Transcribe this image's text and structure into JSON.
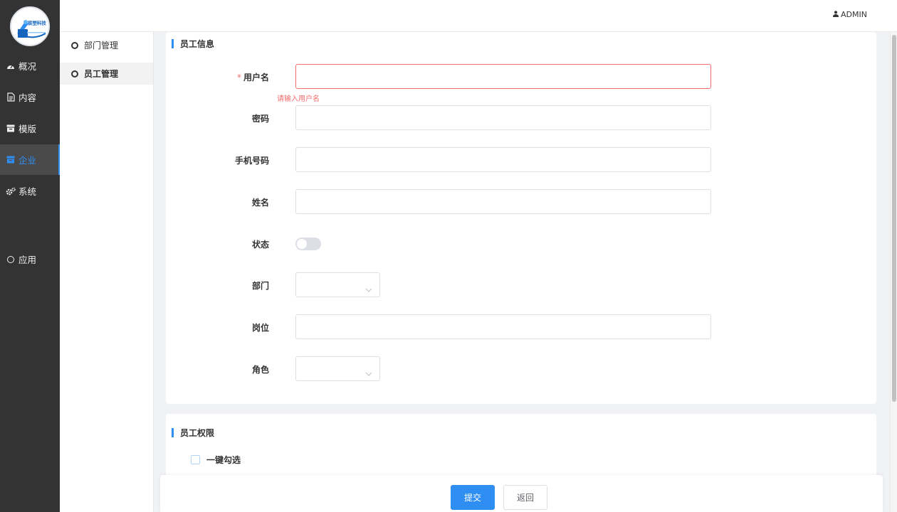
{
  "brand": {
    "logo_text": "宸塑科技"
  },
  "sidebar": {
    "items": [
      {
        "label": "概况",
        "icon": "dashboard-icon",
        "active": false
      },
      {
        "label": "内容",
        "icon": "document-icon",
        "active": false
      },
      {
        "label": "模版",
        "icon": "template-icon",
        "active": false
      },
      {
        "label": "企业",
        "icon": "enterprise-icon",
        "active": true
      },
      {
        "label": "系统",
        "icon": "gears-icon",
        "active": false
      },
      {
        "label": "应用",
        "icon": "circle-icon",
        "active": false
      }
    ]
  },
  "header": {
    "user": "ADMIN",
    "user_icon": "user-icon"
  },
  "submenu": {
    "items": [
      {
        "label": "部门管理",
        "active": false
      },
      {
        "label": "员工管理",
        "active": true
      }
    ]
  },
  "form": {
    "section_title": "员工信息",
    "required_mark": "*",
    "fields": {
      "username": {
        "label": "用户名",
        "value": "",
        "placeholder": "",
        "error": "请输入用户名"
      },
      "password": {
        "label": "密码",
        "value": "",
        "placeholder": ""
      },
      "phone": {
        "label": "手机号码",
        "value": "",
        "placeholder": ""
      },
      "name": {
        "label": "姓名",
        "value": "",
        "placeholder": ""
      },
      "status": {
        "label": "状态",
        "on": false
      },
      "department": {
        "label": "部门",
        "value": ""
      },
      "position": {
        "label": "岗位",
        "value": "",
        "placeholder": ""
      },
      "role": {
        "label": "角色",
        "value": ""
      }
    }
  },
  "permissions": {
    "section_title": "员工权限",
    "select_all_label": "一键勾选",
    "checked": false
  },
  "footer": {
    "submit_label": "提交",
    "back_label": "返回"
  },
  "colors": {
    "accent": "#2f8ef2",
    "error": "#f56c6c",
    "sidebar_bg": "#333333"
  }
}
